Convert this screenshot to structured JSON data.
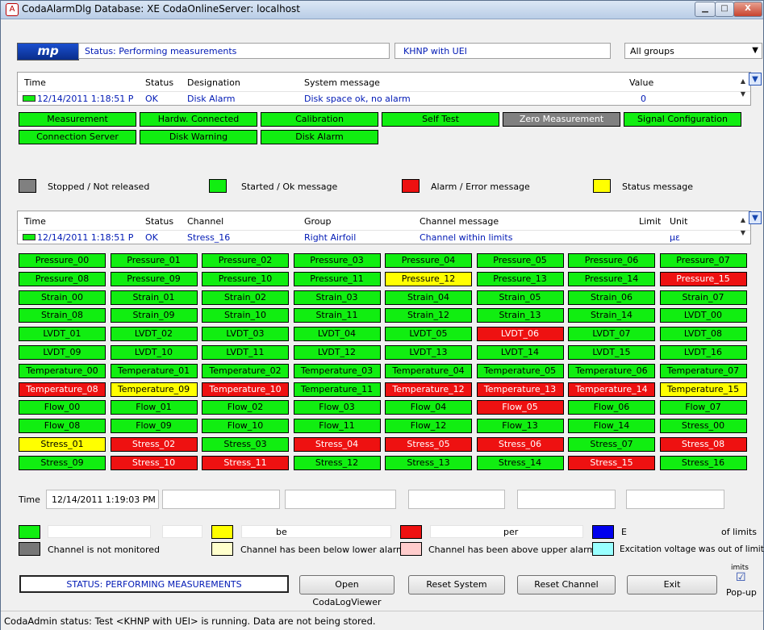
{
  "window": {
    "title": "CodaAlarmDlg Database: XE CodaOnlineServer: localhost",
    "app_icon_letter": "A",
    "btn_minimize": "▁",
    "btn_maximize": "□",
    "btn_close": "X"
  },
  "header": {
    "logo": "mp",
    "status": "Status: Performing measurements",
    "test": "KHNP with UEI",
    "group_select": "All groups",
    "dropdown_glyph": "▼"
  },
  "system_table": {
    "columns": [
      "Time",
      "Status",
      "Designation",
      "System message",
      "Value"
    ],
    "row": {
      "time": "12/14/2011 1:18:51 P",
      "status": "OK",
      "designation": "Disk Alarm",
      "message": "Disk space ok, no alarm",
      "value": "0"
    }
  },
  "system_buttons": [
    {
      "label": "Measurement",
      "color": "g"
    },
    {
      "label": "Hardw. Connected",
      "color": "g"
    },
    {
      "label": "Calibration",
      "color": "g"
    },
    {
      "label": "Self Test",
      "color": "g"
    },
    {
      "label": "Zero Measurement",
      "color": "gr"
    },
    {
      "label": "Signal Configuration",
      "color": "g"
    },
    {
      "label": "Connection Server",
      "color": "g"
    },
    {
      "label": "Disk Warning",
      "color": "g"
    },
    {
      "label": "Disk Alarm",
      "color": "g"
    }
  ],
  "legend_top": [
    {
      "label": "Stopped / Not released",
      "color": "#808080"
    },
    {
      "label": "Started / Ok message",
      "color": "#11ee11"
    },
    {
      "label": "Alarm / Error message",
      "color": "#ee1111"
    },
    {
      "label": "Status message",
      "color": "#ffff00"
    }
  ],
  "channel_table": {
    "columns": [
      "Time",
      "Status",
      "Channel",
      "Group",
      "Channel message",
      "Limit",
      "Unit"
    ],
    "row": {
      "time": "12/14/2011 1:18:51 P",
      "status": "OK",
      "channel": "Stress_16",
      "group": "Right Airfoil",
      "message": "Channel within limits",
      "limit": "",
      "unit": "με"
    }
  },
  "channels": [
    [
      "Pressure_00",
      "g"
    ],
    [
      "Pressure_01",
      "g"
    ],
    [
      "Pressure_02",
      "g"
    ],
    [
      "Pressure_03",
      "g"
    ],
    [
      "Pressure_04",
      "g"
    ],
    [
      "Pressure_05",
      "g"
    ],
    [
      "Pressure_06",
      "g"
    ],
    [
      "Pressure_07",
      "g"
    ],
    [
      "Pressure_08",
      "g"
    ],
    [
      "Pressure_09",
      "g"
    ],
    [
      "Pressure_10",
      "g"
    ],
    [
      "Pressure_11",
      "g"
    ],
    [
      "Pressure_12",
      "y"
    ],
    [
      "Pressure_13",
      "g"
    ],
    [
      "Pressure_14",
      "g"
    ],
    [
      "Pressure_15",
      "r"
    ],
    [
      "Strain_00",
      "g"
    ],
    [
      "Strain_01",
      "g"
    ],
    [
      "Strain_02",
      "g"
    ],
    [
      "Strain_03",
      "g"
    ],
    [
      "Strain_04",
      "g"
    ],
    [
      "Strain_05",
      "g"
    ],
    [
      "Strain_06",
      "g"
    ],
    [
      "Strain_07",
      "g"
    ],
    [
      "Strain_08",
      "g"
    ],
    [
      "Strain_09",
      "g"
    ],
    [
      "Strain_10",
      "g"
    ],
    [
      "Strain_11",
      "g"
    ],
    [
      "Strain_12",
      "g"
    ],
    [
      "Strain_13",
      "g"
    ],
    [
      "Strain_14",
      "g"
    ],
    [
      "LVDT_00",
      "g"
    ],
    [
      "LVDT_01",
      "g"
    ],
    [
      "LVDT_02",
      "g"
    ],
    [
      "LVDT_03",
      "g"
    ],
    [
      "LVDT_04",
      "g"
    ],
    [
      "LVDT_05",
      "g"
    ],
    [
      "LVDT_06",
      "r"
    ],
    [
      "LVDT_07",
      "g"
    ],
    [
      "LVDT_08",
      "g"
    ],
    [
      "LVDT_09",
      "g"
    ],
    [
      "LVDT_10",
      "g"
    ],
    [
      "LVDT_11",
      "g"
    ],
    [
      "LVDT_12",
      "g"
    ],
    [
      "LVDT_13",
      "g"
    ],
    [
      "LVDT_14",
      "g"
    ],
    [
      "LVDT_15",
      "g"
    ],
    [
      "LVDT_16",
      "g"
    ],
    [
      "Temperature_00",
      "g"
    ],
    [
      "Temperature_01",
      "g"
    ],
    [
      "Temperature_02",
      "g"
    ],
    [
      "Temperature_03",
      "g"
    ],
    [
      "Temperature_04",
      "g"
    ],
    [
      "Temperature_05",
      "g"
    ],
    [
      "Temperature_06",
      "g"
    ],
    [
      "Temperature_07",
      "g"
    ],
    [
      "Temperature_08",
      "r"
    ],
    [
      "Temperature_09",
      "y"
    ],
    [
      "Temperature_10",
      "r"
    ],
    [
      "Temperature_11",
      "g"
    ],
    [
      "Temperature_12",
      "r"
    ],
    [
      "Temperature_13",
      "r"
    ],
    [
      "Temperature_14",
      "r"
    ],
    [
      "Temperature_15",
      "y"
    ],
    [
      "Flow_00",
      "g"
    ],
    [
      "Flow_01",
      "g"
    ],
    [
      "Flow_02",
      "g"
    ],
    [
      "Flow_03",
      "g"
    ],
    [
      "Flow_04",
      "g"
    ],
    [
      "Flow_05",
      "r"
    ],
    [
      "Flow_06",
      "g"
    ],
    [
      "Flow_07",
      "g"
    ],
    [
      "Flow_08",
      "g"
    ],
    [
      "Flow_09",
      "g"
    ],
    [
      "Flow_10",
      "g"
    ],
    [
      "Flow_11",
      "g"
    ],
    [
      "Flow_12",
      "g"
    ],
    [
      "Flow_13",
      "g"
    ],
    [
      "Flow_14",
      "g"
    ],
    [
      "Stress_00",
      "g"
    ],
    [
      "Stress_01",
      "y"
    ],
    [
      "Stress_02",
      "r"
    ],
    [
      "Stress_03",
      "g"
    ],
    [
      "Stress_04",
      "r"
    ],
    [
      "Stress_05",
      "r"
    ],
    [
      "Stress_06",
      "r"
    ],
    [
      "Stress_07",
      "g"
    ],
    [
      "Stress_08",
      "r"
    ],
    [
      "Stress_09",
      "g"
    ],
    [
      "Stress_10",
      "r"
    ],
    [
      "Stress_11",
      "r"
    ],
    [
      "Stress_12",
      "g"
    ],
    [
      "Stress_13",
      "g"
    ],
    [
      "Stress_14",
      "g"
    ],
    [
      "Stress_15",
      "r"
    ],
    [
      "Stress_16",
      "g"
    ]
  ],
  "time_label": "Time",
  "time_value": "12/14/2011 1:19:03 PM",
  "legend_bottom": {
    "frag_be": "be",
    "frag_per": "per",
    "frag_E": "E",
    "frag_of_limits": "of limits",
    "not_monitored": "Channel is not monitored",
    "below_lower": "Channel has been below lower alarm",
    "above_upper": "Channel has been above upper alarm",
    "excitation": "Excitation voltage was out of limits"
  },
  "footer": {
    "status_box": "STATUS: PERFORMING MEASUREMENTS",
    "open_log": "Open CodaLogViewer",
    "reset_system": "Reset System",
    "reset_channel": "Reset Channel",
    "exit": "Exit",
    "limits_fragment": "imits",
    "popup_label": "Pop-up",
    "popup_checked": "☑"
  },
  "statusbar": "CodaAdmin status: Test <KHNP with UEI> is running. Data are not being stored."
}
